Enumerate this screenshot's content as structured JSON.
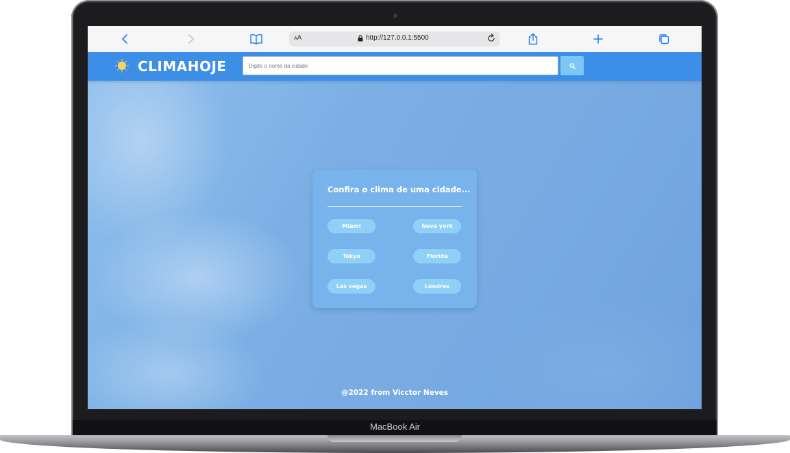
{
  "device": {
    "label": "MacBook Air"
  },
  "browser": {
    "back_icon": "chevron-left-icon",
    "forward_icon": "chevron-right-icon",
    "bookmarks_icon": "book-icon",
    "text_size_label": "AA",
    "url": "http://127.0.0.1:5500",
    "lock_icon": "lock-icon",
    "reload_icon": "reload-icon",
    "share_icon": "share-icon",
    "new_tab_icon": "plus-icon",
    "tabs_icon": "tabs-icon"
  },
  "header": {
    "logo_icon": "sun-icon",
    "logo_text": "CLIMAHOJE",
    "search": {
      "placeholder": "Digite o nome da cidade",
      "value": ""
    },
    "search_button_icon": "search-icon"
  },
  "card": {
    "title": "Confira o clima de uma cidade...",
    "cities": [
      "Miami",
      "Nova york",
      "Tokyo",
      "Florida",
      "Las vegas",
      "Londres"
    ]
  },
  "footer": {
    "text": "@2022 from Vicctor Neves"
  },
  "colors": {
    "header_bar": "#3d8ee6",
    "search_button": "#7dc7f5",
    "city_button": "#8fd0f7",
    "sky": "#7aaee4",
    "safari_accent": "#1a7cf5"
  }
}
